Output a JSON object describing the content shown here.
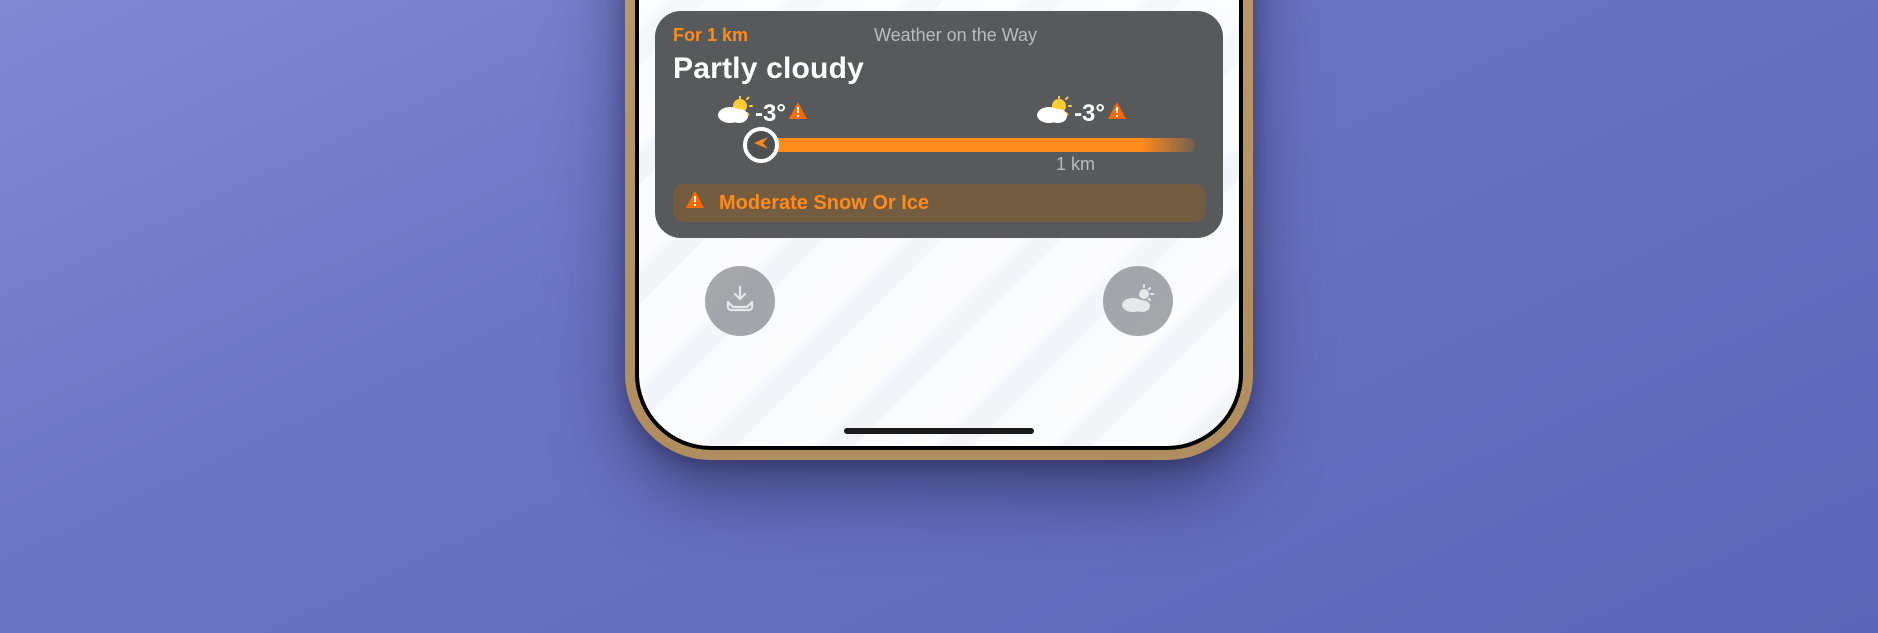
{
  "widget": {
    "for_distance": "For 1 km",
    "app_name": "Weather on the Way",
    "condition": "Partly cloudy",
    "start": {
      "temp": "-3°"
    },
    "end": {
      "temp": "-3°"
    },
    "distance_label": "1 km",
    "alert_text": "Moderate Snow Or Ice"
  },
  "colors": {
    "accent": "#ff8c1a",
    "card_bg": "#58595a"
  }
}
